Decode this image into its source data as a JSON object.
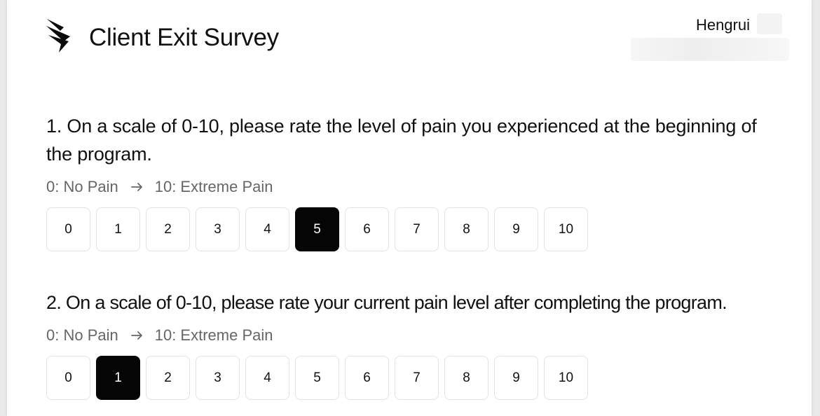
{
  "header": {
    "title": "Client Exit Survey",
    "logo_icon": "chevron-stack-logo-icon",
    "user_name": "Hengrui"
  },
  "questions": [
    {
      "number": 1,
      "text": "1. On a scale of 0-10, please rate the level of pain you experienced at the beginning of the program.",
      "scale_min_label": "0: No Pain",
      "scale_max_label": "10: Extreme Pain",
      "options": [
        "0",
        "1",
        "2",
        "3",
        "4",
        "5",
        "6",
        "7",
        "8",
        "9",
        "10"
      ],
      "selected": "5"
    },
    {
      "number": 2,
      "text": "2. On a scale of 0-10, please rate your current pain level after completing the program.",
      "scale_min_label": "0: No Pain",
      "scale_max_label": "10: Extreme Pain",
      "options": [
        "0",
        "1",
        "2",
        "3",
        "4",
        "5",
        "6",
        "7",
        "8",
        "9",
        "10"
      ],
      "selected": "1"
    }
  ],
  "colors": {
    "selected_bg": "#050505",
    "selected_text": "#ffffff",
    "hint_text": "#666666",
    "button_border": "#e2e2e2"
  }
}
